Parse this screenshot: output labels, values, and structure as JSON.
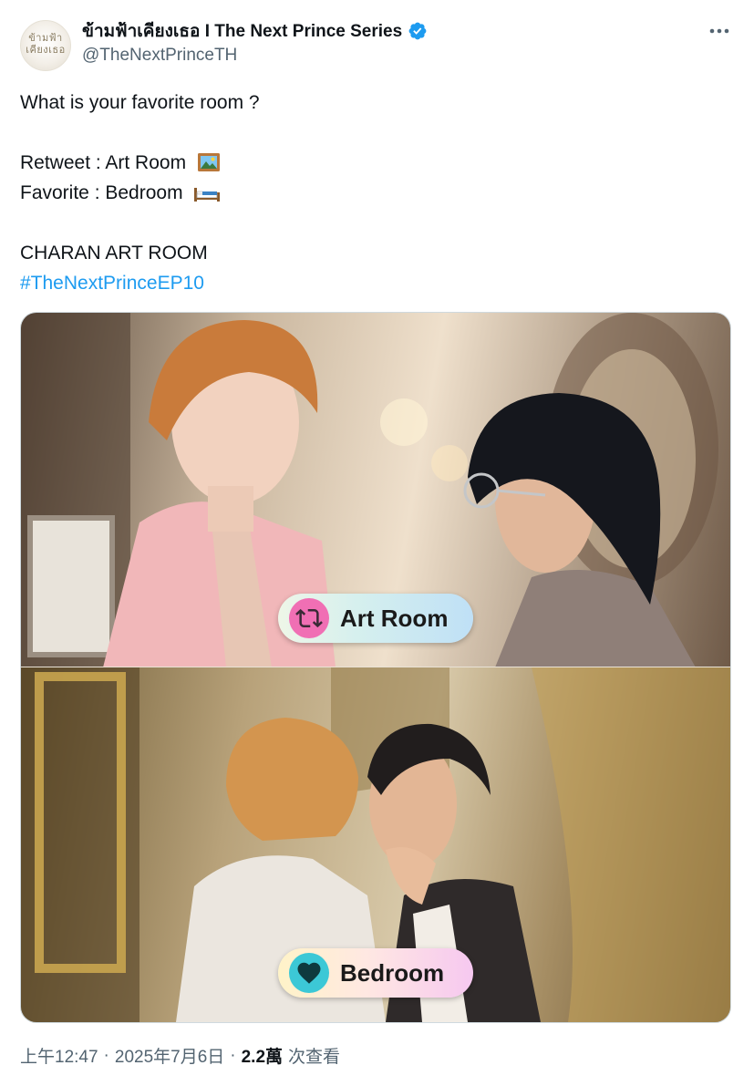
{
  "author": {
    "avatar_text": "ข้ามฟ้า เคียงเธอ",
    "display_name": "ข้ามฟ้าเคียงเธอ I The Next Prince Series",
    "handle": "@TheNextPrinceTH",
    "verified": true
  },
  "tweet": {
    "lines": [
      "What is your favorite room ?",
      "",
      "Retweet : Art Room",
      "Favorite : Bedroom",
      "",
      "CHARAN ART ROOM"
    ],
    "hashtag": "#TheNextPrinceEP10"
  },
  "media": {
    "top_label": "Art Room",
    "bottom_label": "Bedroom",
    "top_icon": "retweet-icon",
    "bottom_icon": "heart-icon"
  },
  "footer": {
    "time": "上午12:47",
    "date": "2025年7月6日",
    "views": "2.2萬",
    "views_label": "次查看",
    "separator": "·"
  },
  "colors": {
    "link": "#1d9bf0",
    "secondary_text": "#536471",
    "verified": "#1d9bf0",
    "retweet_badge": "#f06fb4",
    "heart_badge": "#3cc8d6"
  }
}
